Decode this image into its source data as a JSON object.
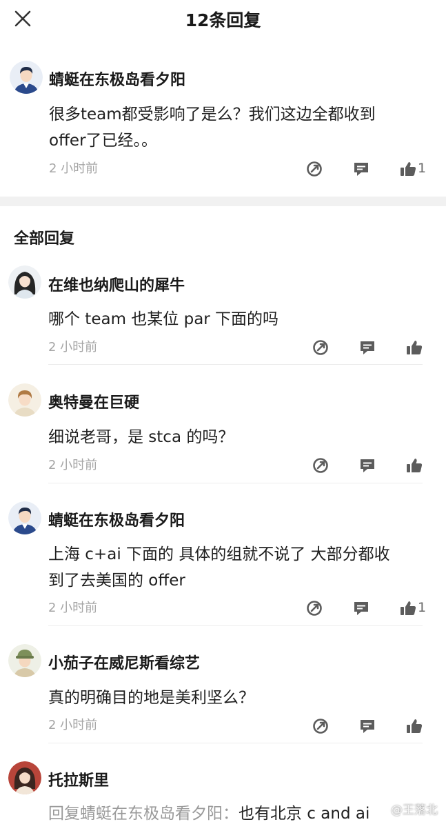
{
  "header": {
    "title": "12条回复"
  },
  "main_comment": {
    "username": "蜻蜓在东极岛看夕阳",
    "line1": "很多team都受影响了是么？我们这边全都收到",
    "line2": "offer了已经。。",
    "time": "2 小时前",
    "likes": "1"
  },
  "section": {
    "title": "全部回复"
  },
  "replies": [
    {
      "username": "在维也纳爬山的犀牛",
      "line1": "哪个 team 也某位 par 下面的吗",
      "time": "2 小时前"
    },
    {
      "username": "奥特曼在巨硬",
      "line1": "细说老哥，是 stca 的吗？",
      "time": "2 小时前"
    },
    {
      "username": "蜻蜓在东极岛看夕阳",
      "line1": "上海 c+ai 下面的 具体的组就不说了 大部分都收",
      "line2": "到了去美国的 offer",
      "time": "2 小时前",
      "likes": "1"
    },
    {
      "username": "小茄子在威尼斯看综艺",
      "line1": "真的明确目的地是美利坚么？",
      "time": "2 小时前"
    },
    {
      "username": "托拉斯里",
      "reply_prefix": "回复蜻蜓在东极岛看夕阳：",
      "reply_body": "也有北京 c and ai"
    }
  ],
  "watermark": "@王落北",
  "icons": {
    "close": "close-icon",
    "share": "share-icon",
    "comment": "comment-icon",
    "like": "thumbs-up-icon"
  },
  "colors": {
    "text": "#1f1f1f",
    "muted": "#a5a5a5",
    "icon": "#5c5c5c",
    "divider": "#f1f1f1"
  }
}
